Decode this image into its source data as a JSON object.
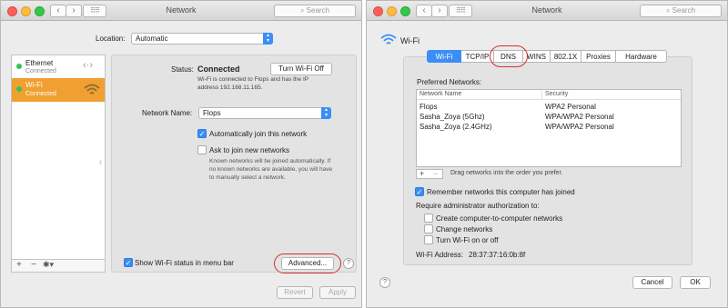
{
  "left": {
    "title": "Network",
    "search_placeholder": "Search",
    "location_label": "Location:",
    "location_value": "Automatic",
    "sidebar": [
      {
        "name": "Ethernet",
        "status": "Connected",
        "icon": "ethernet-arrows-icon"
      },
      {
        "name": "Wi-Fi",
        "status": "Connected",
        "icon": "wifi-icon"
      }
    ],
    "status_label": "Status:",
    "status_value": "Connected",
    "turn_off_button": "Turn Wi-Fi Off",
    "status_desc_1": "Wi-Fi is connected to Flops and has the IP",
    "status_desc_2": "address 192.168.11.165.",
    "network_name_label": "Network Name:",
    "network_name_value": "Flops",
    "auto_join": "Automatically join this network",
    "ask_join": "Ask to join new networks",
    "ask_desc_1": "Known networks will be joined automatically. If",
    "ask_desc_2": "no known networks are available, you will have",
    "ask_desc_3": "to manually select a network.",
    "show_status": "Show Wi-Fi status in menu bar",
    "advanced_button": "Advanced...",
    "revert_button": "Revert",
    "apply_button": "Apply",
    "help": "?"
  },
  "right": {
    "title": "Network",
    "search_placeholder": "Search",
    "wifi_title": "Wi-Fi",
    "tabs": [
      "Wi-Fi",
      "TCP/IP",
      "DNS",
      "WINS",
      "802.1X",
      "Proxies",
      "Hardware"
    ],
    "preferred_label": "Preferred Networks:",
    "col_network": "Network Name",
    "col_security": "Security",
    "rows": [
      {
        "name": "Flops",
        "security": "WPA2 Personal"
      },
      {
        "name": "Sasha_Zoya (5Ghz)",
        "security": "WPA/WPA2 Personal"
      },
      {
        "name": "Sasha_Zoya (2.4GHz)",
        "security": "WPA/WPA2 Personal"
      }
    ],
    "drag_hint": "Drag networks into the order you prefer.",
    "remember": "Remember networks this computer has joined",
    "require_admin": "Require administrator authorization to:",
    "create_networks": "Create computer-to-computer networks",
    "change_networks": "Change networks",
    "turn_wifi": "Turn Wi-Fi on or off",
    "wifi_address_label": "Wi-Fi Address:",
    "wifi_address_value": "28:37:37:16:0b:8f",
    "cancel_button": "Cancel",
    "ok_button": "OK",
    "help": "?"
  },
  "colors": {
    "accent": "#3b8ef6",
    "selected_row": "#f0a030",
    "highlight_ring": "#d0312d"
  }
}
